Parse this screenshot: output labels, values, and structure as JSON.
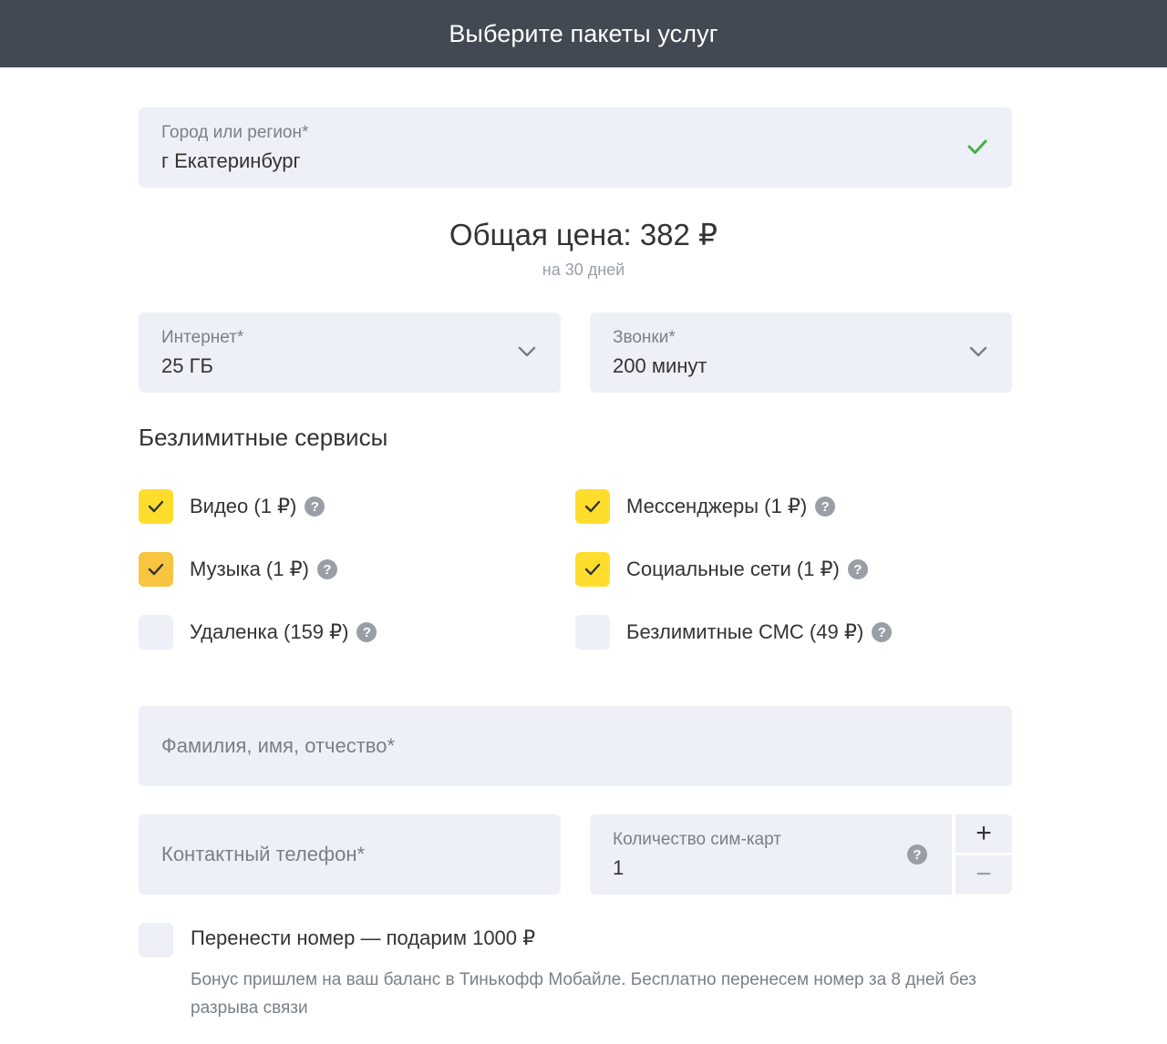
{
  "header": {
    "title": "Выберите пакеты услуг"
  },
  "region": {
    "label": "Город или регион*",
    "value": "г Екатеринбург",
    "status_icon": "check-icon"
  },
  "price": {
    "total": "Общая цена: 382 ₽",
    "period": "на 30 дней"
  },
  "internet": {
    "label": "Интернет*",
    "value": "25 ГБ"
  },
  "calls": {
    "label": "Звонки*",
    "value": "200 минут"
  },
  "services": {
    "title": "Безлимитные сервисы",
    "items": [
      {
        "label": "Видео (1 ₽)",
        "checked": true
      },
      {
        "label": "Мессенджеры (1 ₽)",
        "checked": true
      },
      {
        "label": "Музыка (1 ₽)",
        "checked": true
      },
      {
        "label": "Социальные сети (1 ₽)",
        "checked": true
      },
      {
        "label": "Удаленка (159 ₽)",
        "checked": false
      },
      {
        "label": "Безлимитные СМС (49 ₽)",
        "checked": false
      }
    ]
  },
  "fullname": {
    "placeholder": "Фамилия, имя, отчество*"
  },
  "phone": {
    "placeholder": "Контактный телефон*"
  },
  "sim_count": {
    "label": "Количество сим-карт",
    "value": "1",
    "plus": "+",
    "minus": "−"
  },
  "transfer": {
    "label": "Перенести номер — подарим 1000 ₽",
    "checked": false,
    "note": "Бонус пришлем на ваш баланс в Тинькофф Мобайле. Бесплатно перенесем номер за 8 дней без разрыва связи"
  },
  "colors": {
    "header_bg": "#424953",
    "field_bg": "#eef0f8",
    "checkbox_on": "#ffdd2d",
    "check_green": "#3fb24d"
  }
}
